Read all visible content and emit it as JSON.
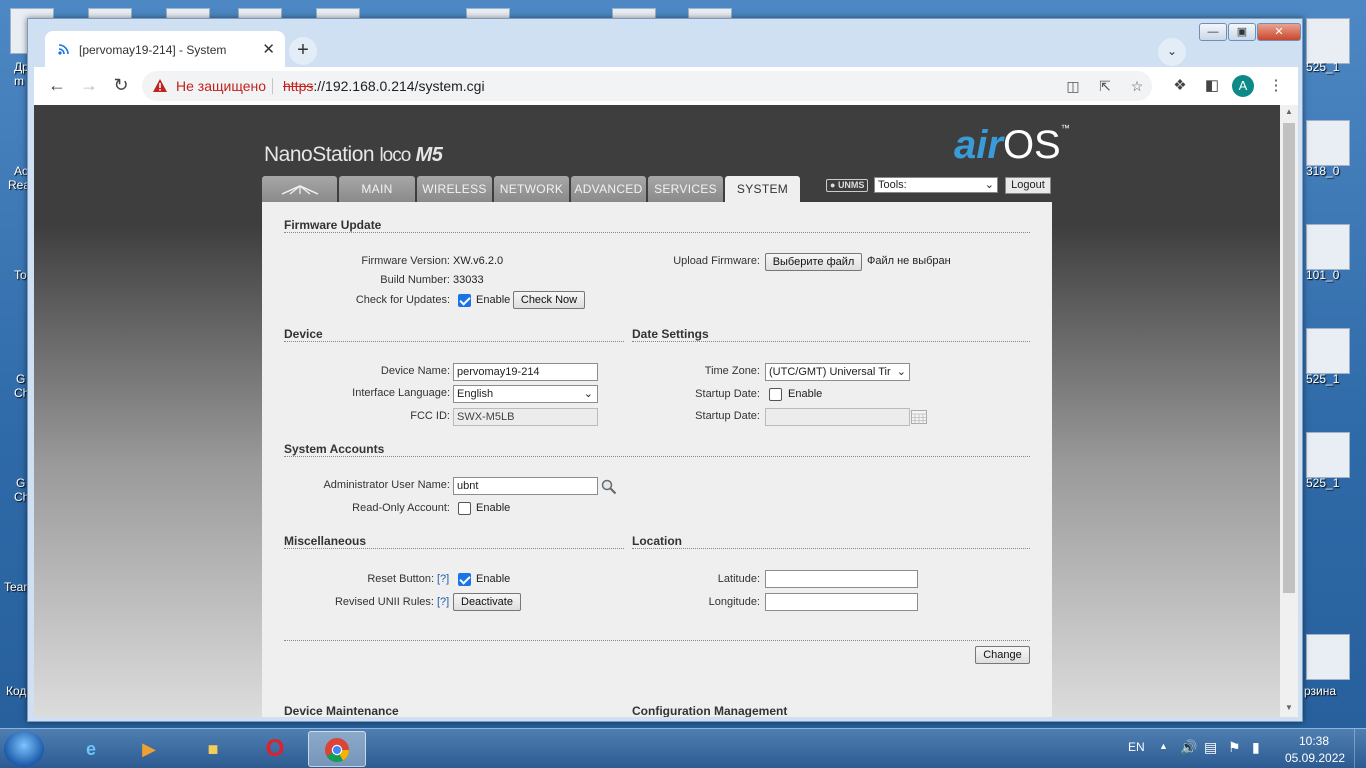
{
  "browser": {
    "tab_title": "[pervomay19-214] - System",
    "security_label": "Не защищено",
    "url_scheme": "https",
    "url_rest": "://192.168.0.214/system.cgi",
    "profile_initial": "A"
  },
  "desktop": {
    "labels_left": [
      "Др",
      "m",
      "Ac",
      "Rea",
      "To",
      "G",
      "Ch",
      "G",
      "Ch",
      "Team",
      "Код"
    ],
    "labels_right": [
      "525_1",
      "318_0",
      "101_0",
      "525_1",
      "525_1",
      "рзина"
    ]
  },
  "airos": {
    "product_name": "NanoStation",
    "product_variant": "loco",
    "product_model": "M5",
    "logo_air": "air",
    "logo_os": "OS",
    "logo_tm": "™",
    "tabs": [
      "MAIN",
      "WIRELESS",
      "NETWORK",
      "ADVANCED",
      "SERVICES",
      "SYSTEM"
    ],
    "active_tab": "SYSTEM",
    "unms_label": "UNMS",
    "tools_select": "Tools:",
    "logout_label": "Logout"
  },
  "firmware": {
    "section": "Firmware Update",
    "version_label": "Firmware Version:",
    "version_value": "XW.v6.2.0",
    "build_label": "Build Number:",
    "build_value": "33033",
    "check_label": "Check for Updates:",
    "check_enable": "Enable",
    "check_checked": true,
    "check_now": "Check Now",
    "upload_label": "Upload Firmware:",
    "choose_file": "Выберите файл",
    "no_file": "Файл не выбран"
  },
  "device": {
    "section": "Device",
    "name_label": "Device Name:",
    "name_value": "pervomay19-214",
    "lang_label": "Interface Language:",
    "lang_value": "English",
    "fcc_label": "FCC ID:",
    "fcc_value": "SWX-M5LB"
  },
  "date": {
    "section": "Date Settings",
    "tz_label": "Time Zone:",
    "tz_value": "(UTC/GMT) Universal Tir",
    "startup_label": "Startup Date:",
    "startup_enable": "Enable",
    "startup_date_label": "Startup Date:"
  },
  "accounts": {
    "section": "System Accounts",
    "admin_label": "Administrator User Name:",
    "admin_value": "ubnt",
    "readonly_label": "Read-Only Account:",
    "readonly_enable": "Enable"
  },
  "misc": {
    "section": "Miscellaneous",
    "reset_label": "Reset Button:",
    "help": "[?]",
    "reset_enable": "Enable",
    "unii_label": "Revised UNII Rules:",
    "deactivate": "Deactivate"
  },
  "location": {
    "section": "Location",
    "lat_label": "Latitude:",
    "lon_label": "Longitude:"
  },
  "actions": {
    "change": "Change"
  },
  "bottom": {
    "maintenance": "Device Maintenance",
    "config": "Configuration Management"
  },
  "taskbar": {
    "lang": "EN",
    "time": "10:38",
    "date": "05.09.2022"
  }
}
